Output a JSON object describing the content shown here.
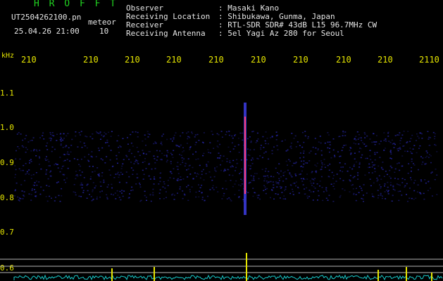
{
  "header": {
    "app_title": "H R O F F T",
    "filename": "UT2504262100.pn",
    "meteor_label": "meteor",
    "datetime": "25.04.26 21:00",
    "count": "10",
    "fields": [
      {
        "label": "Observer",
        "value": ": Masaki Kano"
      },
      {
        "label": "Receiving Location",
        "value": ": Shibukawa, Gunma, Japan"
      },
      {
        "label": "Receiver",
        "value": ": RTL-SDR SDR# 43dB L15 96.7MHz CW"
      },
      {
        "label": "Receiving Antenna",
        "value": ": 5el Yagi Az 280 for Seoul"
      }
    ]
  },
  "axis": {
    "unit": "kHz",
    "time_ticks": [
      "210",
      "210",
      "210",
      "210",
      "210",
      "210",
      "210",
      "210",
      "210",
      "2110"
    ],
    "freq_ticks": [
      "1.1",
      "1.0",
      "0.9",
      "0.8",
      "0.7",
      "0.6"
    ]
  },
  "colors": {
    "background": "#000000",
    "noise": "#2a2ab8",
    "meteor_trail_core": "#ff3a6a",
    "spectrum": "#18c8c8",
    "spikes": "#e6e600",
    "reference_lines": "#b4b4b4"
  }
}
